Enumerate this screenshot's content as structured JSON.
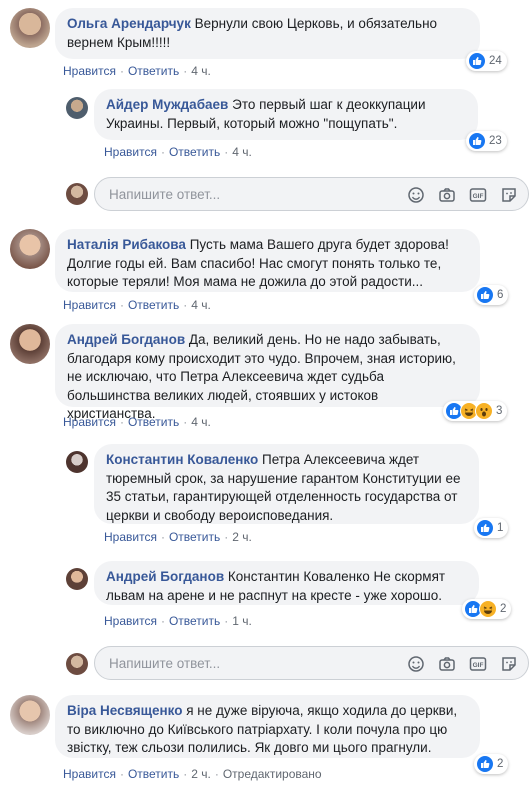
{
  "comments": [
    {
      "author": "Ольга Арендарчук",
      "text": "Вернули свою Церковь, и обязательно вернем Крым!!!!!",
      "like": "Нравится",
      "reply": "Ответить",
      "time": "4 ч.",
      "reactions": "24"
    },
    {
      "author": "Айдер Муждабаев",
      "text": "Это первый шаг к деоккупации Украины. Первый, который можно \"пощупать\".",
      "like": "Нравится",
      "reply": "Ответить",
      "time": "4 ч.",
      "reactions": "23"
    },
    {
      "author": "Наталія Рибакова",
      "text": "Пусть мама Вашего друга будет здорова! Долгие годы ей. Вам спасибо! Нас смогут понять только те, которые теряли! Моя мама не дожила до этой радости...",
      "like": "Нравится",
      "reply": "Ответить",
      "time": "4 ч.",
      "reactions": "6"
    },
    {
      "author": "Андрей Богданов",
      "text": "Да, великий день. Но не надо забывать, благодаря кому происходит это чудо. Впрочем, зная историю, не исключаю, что Петра Алексеевича ждет судьба большинства великих людей, стоявших у истоков христианства.",
      "like": "Нравится",
      "reply": "Ответить",
      "time": "4 ч.",
      "reactions": "3"
    },
    {
      "author": "Константин Коваленко",
      "text": "Петра Алексеевича ждет тюремный срок, за нарушение гарантом Конституции ее 35 статьи, гарантирующей отделенность государства от церкви и свободу вероисповедания.",
      "like": "Нравится",
      "reply": "Ответить",
      "time": "2 ч.",
      "reactions": "1"
    },
    {
      "author": "Андрей Богданов",
      "text": "Константин Коваленко Не скормят львам на арене и не распнут на кресте - уже хорошо.",
      "like": "Нравится",
      "reply": "Ответить",
      "time": "1 ч.",
      "reactions": "2"
    },
    {
      "author": "Віра Несвященко",
      "text": "я не дуже віруюча, якщо ходила до церкви, то виключно до Київського патріархату. І коли почула про цю звістку, теж сльози полились. Як довго ми цього прагнули.",
      "like": "Нравится",
      "reply": "Ответить",
      "time": "2 ч.",
      "edited": "Отредактировано",
      "reactions": "2"
    }
  ],
  "reply_placeholder": "Напишите ответ...",
  "colors": {
    "link": "#385898",
    "bubble": "#f2f3f5",
    "like": "#1877f2"
  },
  "icons": [
    "emoji-icon",
    "camera-icon",
    "gif-icon",
    "sticker-icon",
    "like-reaction-icon",
    "haha-reaction-icon",
    "wow-reaction-icon"
  ]
}
